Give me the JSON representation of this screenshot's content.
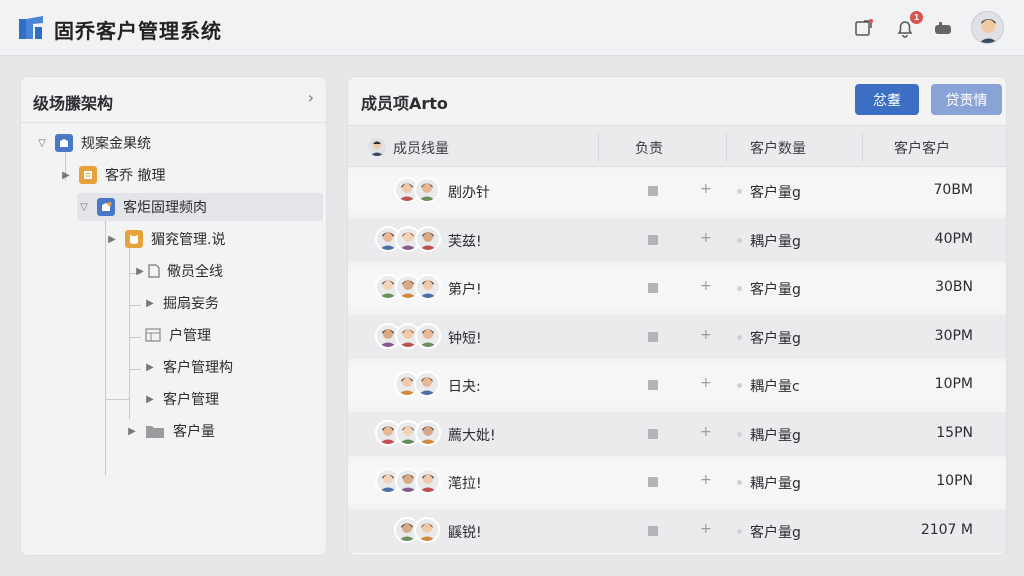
{
  "app": {
    "title": "固乔客户管理系统"
  },
  "header": {
    "notification_count": "1",
    "icons": [
      "external-link-icon",
      "bell-icon",
      "chat-icon"
    ]
  },
  "left_panel": {
    "title": "级场縢架构",
    "collapse": "›",
    "tree": [
      {
        "label": "规案金果统",
        "level": 0,
        "caret": "▽",
        "icon": "app-icon"
      },
      {
        "label": "客乔 撤理",
        "level": 1,
        "caret": "▶",
        "icon": "note-icon"
      },
      {
        "label": "客炬固理频肉",
        "level": 1,
        "caret": "▽",
        "icon": "app-icon",
        "selected": true
      },
      {
        "label": "猸兖管理.说",
        "level": 2,
        "caret": "▶",
        "icon": "book-icon"
      },
      {
        "label": "儆员全线",
        "level": 3,
        "caret": "▶",
        "icon": "doc-icon"
      },
      {
        "label": "掘扇妄务",
        "level": 3,
        "caret": "▶",
        "icon": ""
      },
      {
        "label": "户管理",
        "level": 3,
        "caret": "",
        "icon": "table-icon"
      },
      {
        "label": "客户管理构",
        "level": 3,
        "caret": "▶",
        "icon": ""
      },
      {
        "label": "客户管理",
        "level": 3,
        "caret": "▶",
        "icon": ""
      },
      {
        "label": "客户量",
        "level": 2,
        "caret": "▶",
        "icon": "folder-icon"
      }
    ]
  },
  "right_panel": {
    "title": "成员项Arto",
    "btn_primary": "忿耋",
    "btn_secondary": "贷责情",
    "columns": [
      "成员线量",
      "负责",
      "客户数量",
      "客户客户"
    ],
    "rows": [
      {
        "avatars": 2,
        "name": "剧办针",
        "count": "客户量g",
        "value": "70BM"
      },
      {
        "avatars": 3,
        "name": "芙兹!",
        "count": "耦户量g",
        "value": "40PM"
      },
      {
        "avatars": 3,
        "name": "第户!",
        "count": "客户量g",
        "value": "30BN"
      },
      {
        "avatars": 3,
        "name": "钟短!",
        "count": "客户量g",
        "value": "30PM"
      },
      {
        "avatars": 2,
        "name": "日夬:",
        "count": "耦户量c",
        "value": "10PM"
      },
      {
        "avatars": 3,
        "name": "薦大妣!",
        "count": "耦户量g",
        "value": "15PN"
      },
      {
        "avatars": 3,
        "name": "滗拉!",
        "count": "耦户量g",
        "value": "10PN"
      },
      {
        "avatars": 2,
        "name": "鼷锐!",
        "count": "客户量g",
        "value": "2107 M"
      }
    ]
  },
  "colors": {
    "primary": "#3c6fc4",
    "secondary": "#8aa3d6",
    "badge": "#d9534f"
  }
}
